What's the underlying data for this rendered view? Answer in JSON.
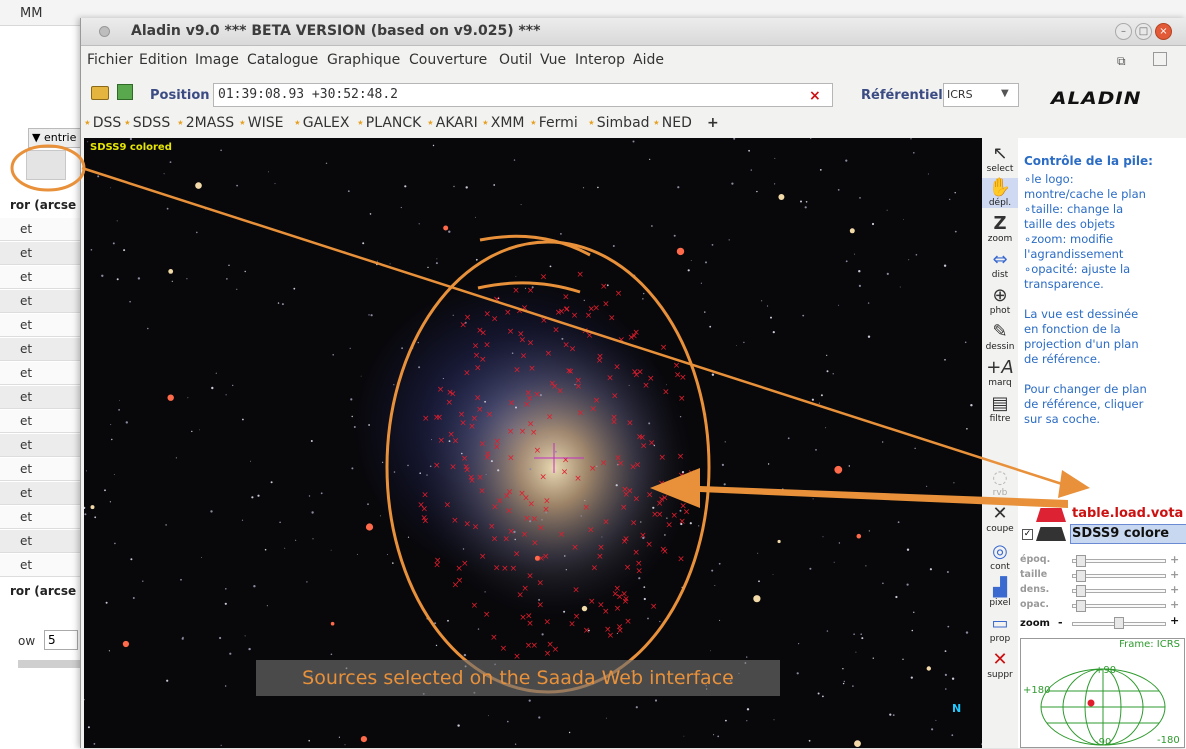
{
  "background_browser": {
    "bookmark_text": "MM",
    "dropdown_label": "▼ entrie",
    "column_header": "ror (arcse",
    "cells": [
      "et",
      "et",
      "et",
      "et",
      "et",
      "et",
      "et",
      "et",
      "et",
      "et",
      "et",
      "et",
      "et",
      "et",
      "et"
    ],
    "rows_label": "ow",
    "rows_value": "5"
  },
  "window": {
    "title": "Aladin v9.0   *** BETA VERSION (based on v9.025) ***",
    "menu": [
      "Fichier",
      "Edition",
      "Image",
      "Catalogue",
      "Graphique",
      "Couverture",
      "Outil",
      "Vue",
      "Interop",
      "Aide"
    ]
  },
  "toolbar": {
    "position_label": "Position",
    "position_value": "01:39:08.93 +30:52:48.2",
    "clear_symbol": "×",
    "frame_label": "Référentiel",
    "frame_value": "ICRS",
    "logo": "ALADIN"
  },
  "quickbar": {
    "items": [
      "DSS",
      "SDSS",
      "2MASS",
      "WISE",
      "GALEX",
      "PLANCK",
      "AKARI",
      "XMM",
      "Fermi",
      "Simbad",
      "NED"
    ],
    "add": "+"
  },
  "sky": {
    "survey_label": "SDSS9 colored"
  },
  "tools": [
    {
      "label": "select",
      "icon": "cursor-icon"
    },
    {
      "label": "dépl.",
      "icon": "hand-icon"
    },
    {
      "label": "zoom",
      "icon": "zoom-icon"
    },
    {
      "label": "dist",
      "icon": "distance-icon"
    },
    {
      "label": "phot",
      "icon": "photometry-icon"
    },
    {
      "label": "dessin",
      "icon": "pencil-icon"
    },
    {
      "label": "marq",
      "icon": "tag-icon"
    },
    {
      "label": "filtre",
      "icon": "filter-icon"
    },
    {
      "label": "rvb",
      "icon": "rgb-icon"
    },
    {
      "label": "coupe",
      "icon": "scissors-icon"
    },
    {
      "label": "cont",
      "icon": "contour-icon"
    },
    {
      "label": "pixel",
      "icon": "histogram-icon"
    },
    {
      "label": "prop",
      "icon": "properties-icon"
    },
    {
      "label": "suppr",
      "icon": "delete-icon"
    }
  ],
  "help": {
    "title": "Contrôle de la pile:",
    "lines": [
      "∘le logo:",
      "montre/cache le plan",
      "∘taille: change la",
      "taille des objets",
      "∘zoom: modifie",
      "l'agrandissement",
      "∘opacité: ajuste la",
      "transparence.",
      "",
      "La vue est dessinée",
      "en fonction de la",
      "projection d'un plan",
      "de référence.",
      "",
      "Pour changer de plan",
      "de référence, cliquer",
      "sur sa coche."
    ]
  },
  "planes": {
    "catalog": "table.load.vota",
    "image": "SDSS9 colore"
  },
  "sliders": [
    {
      "label": "époq.",
      "level": 0.05
    },
    {
      "label": "taille",
      "level": 0.05
    },
    {
      "label": "dens.",
      "level": 0.05
    },
    {
      "label": "opac.",
      "level": 0.05
    }
  ],
  "zoom": {
    "label": "zoom",
    "minus": "-",
    "plus": "+",
    "level": 0.5
  },
  "frame_view": {
    "label": "Frame: ICRS",
    "top": "+90",
    "bottom": "-90",
    "left": "+180",
    "right": "-180"
  },
  "compass": "N",
  "caption": "Sources selected on the Saada Web interface",
  "colors": {
    "annotation": "#e8913a",
    "markers": "#e11d2d",
    "help_text": "#2b6cc4"
  }
}
